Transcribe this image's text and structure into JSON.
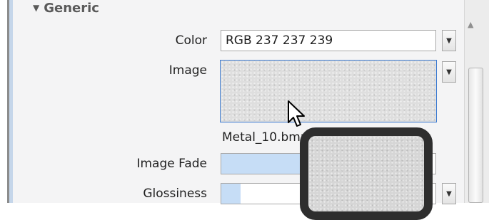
{
  "group": {
    "title": "Generic",
    "collapse_glyph": "▼"
  },
  "properties": {
    "color": {
      "label": "Color",
      "value": "RGB 237 237 239"
    },
    "image": {
      "label": "Image",
      "filename": "Metal_10.bmp"
    },
    "image_fade": {
      "label": "Image Fade",
      "level_percent": 38
    },
    "glossiness": {
      "label": "Glossiness",
      "level_percent": 9
    }
  },
  "icons": {
    "dropdown": "dropdown-arrow-icon",
    "scroll_up": "scroll-up-arrow-icon",
    "cursor": "mouse-pointer-icon"
  },
  "colors": {
    "accent_border": "#3d7bd1",
    "slider_fill": "#c6ddf6",
    "drag_frame": "#2e2e2e",
    "panel_bg": "#f4f4f5"
  }
}
